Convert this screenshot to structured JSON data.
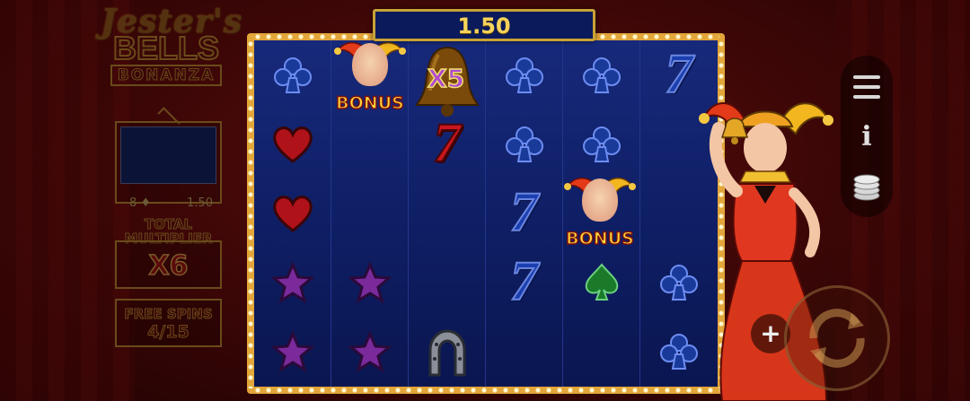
{
  "logo": {
    "line1": "Jester's",
    "line2": "BELLS",
    "line3": "BONANZA"
  },
  "win_display": {
    "value": "1.50"
  },
  "collect_panel": {
    "count": "8",
    "count_icon": "diamond-icon",
    "value": "1.50"
  },
  "total_multiplier": {
    "label_line1": "TOTAL",
    "label_line2": "MULTIPLIER",
    "value": "X6"
  },
  "free_spins": {
    "label": "FREE SPINS",
    "count": "4/15"
  },
  "bell_multiplier": {
    "label": "X5"
  },
  "bonus_label": "BONUS",
  "reels": [
    [
      "club",
      "heart",
      "heart",
      "star",
      "star"
    ],
    [
      "bonus",
      "empty",
      "empty",
      "star",
      "star"
    ],
    [
      "bell",
      "seven-red",
      "empty",
      "empty",
      "horseshoe"
    ],
    [
      "club",
      "club",
      "seven-blue",
      "seven-blue",
      "empty"
    ],
    [
      "club",
      "club",
      "bonus",
      "spade",
      "empty"
    ],
    [
      "seven-blue",
      "empty",
      "empty",
      "club",
      "club"
    ]
  ],
  "side_menu": {
    "icons": [
      "menu-icon",
      "info-icon",
      "coin-stack-icon"
    ]
  },
  "buttons": {
    "plus_label": "+",
    "spin_icon": "spin-arrows-icon"
  },
  "colors": {
    "frame_gold": "#e2a63a",
    "reel_blue": "#0f1f66",
    "background_red": "#3a0606",
    "win_gold_text": "#f6d35a"
  }
}
